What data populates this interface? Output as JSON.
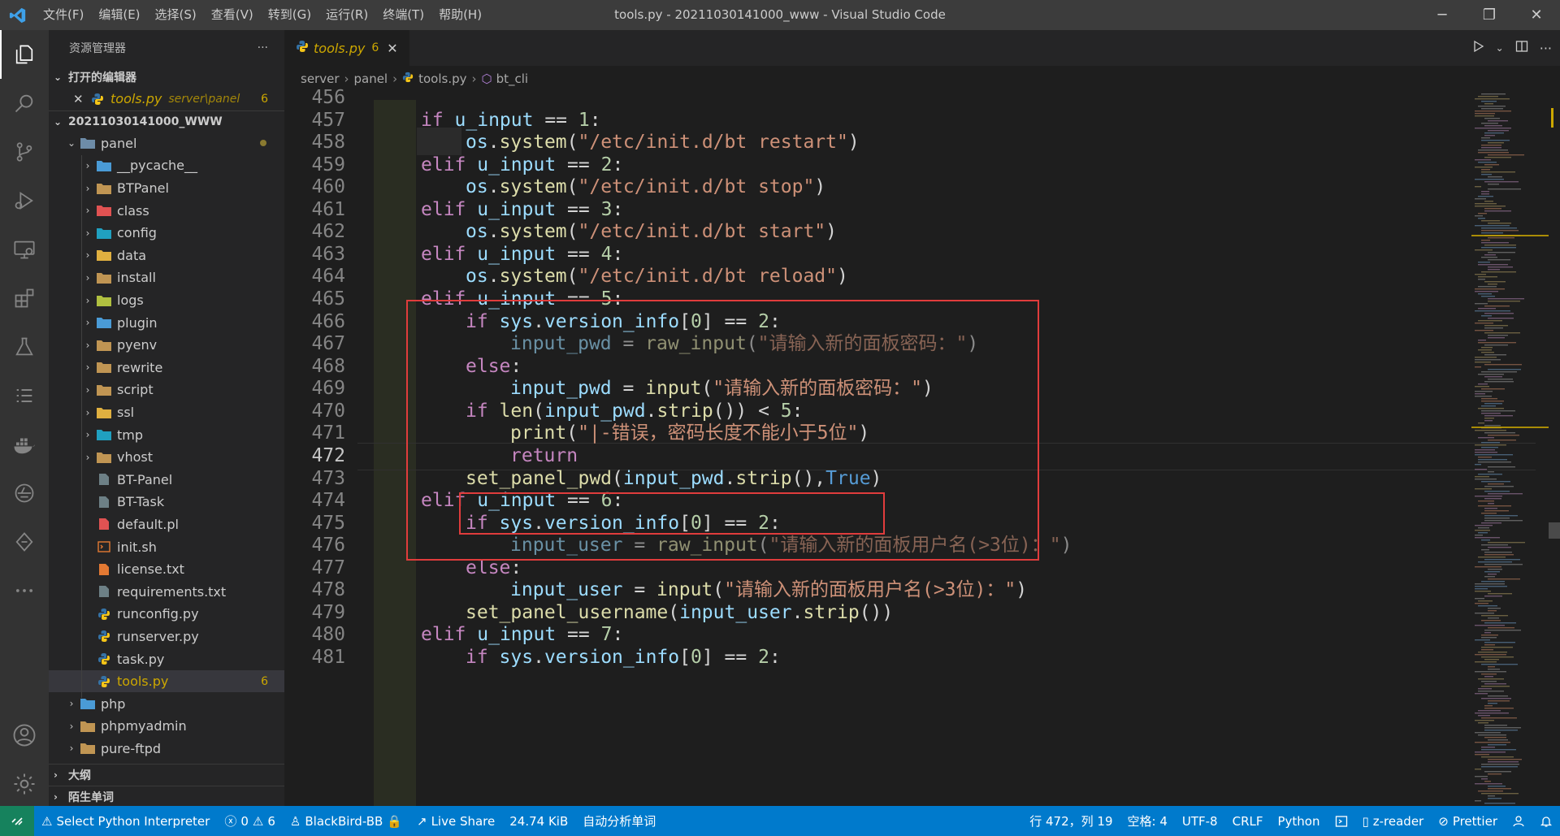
{
  "window": {
    "title": "tools.py - 20211030141000_www - Visual Studio Code",
    "menu": [
      "文件(F)",
      "编辑(E)",
      "选择(S)",
      "查看(V)",
      "转到(G)",
      "运行(R)",
      "终端(T)",
      "帮助(H)"
    ],
    "controls": {
      "minimize": "─",
      "restore": "❐",
      "close": "✕"
    }
  },
  "activity": {
    "icons": [
      "explorer-icon",
      "search-icon",
      "source-control-icon",
      "run-debug-icon",
      "remote-explorer-icon",
      "extensions-icon",
      "testing-icon",
      "list-icon",
      "docker-icon",
      "cloud-icon",
      "git-graph-icon",
      "more-icon"
    ],
    "bottom": [
      "account-icon",
      "settings-gear-icon"
    ]
  },
  "sidebar": {
    "title": "资源管理器",
    "more": "···",
    "open_editors_label": "打开的编辑器",
    "open_editor": {
      "name": "tools.py",
      "path": "server\\panel",
      "badge": "6"
    },
    "root_label": "20211030141000_WWW",
    "panel_folder": "panel",
    "items": [
      {
        "label": "__pycache__",
        "type": "folder",
        "icon": "pycache-folder-icon",
        "color": "#4a9bd6"
      },
      {
        "label": "BTPanel",
        "type": "folder",
        "icon": "folder-icon",
        "color": "#c09553"
      },
      {
        "label": "class",
        "type": "folder",
        "icon": "class-folder-icon",
        "color": "#e05252"
      },
      {
        "label": "config",
        "type": "folder",
        "icon": "config-folder-icon",
        "color": "#20a0c0"
      },
      {
        "label": "data",
        "type": "folder",
        "icon": "data-folder-icon",
        "color": "#e0b040"
      },
      {
        "label": "install",
        "type": "folder",
        "icon": "folder-icon",
        "color": "#c09553"
      },
      {
        "label": "logs",
        "type": "folder",
        "icon": "logs-folder-icon",
        "color": "#b0c040"
      },
      {
        "label": "plugin",
        "type": "folder",
        "icon": "plugin-folder-icon",
        "color": "#4a9bd6"
      },
      {
        "label": "pyenv",
        "type": "folder",
        "icon": "folder-icon",
        "color": "#c09553"
      },
      {
        "label": "rewrite",
        "type": "folder",
        "icon": "folder-icon",
        "color": "#c09553"
      },
      {
        "label": "script",
        "type": "folder",
        "icon": "folder-icon",
        "color": "#c09553"
      },
      {
        "label": "ssl",
        "type": "folder",
        "icon": "ssl-folder-icon",
        "color": "#e0b040"
      },
      {
        "label": "tmp",
        "type": "folder",
        "icon": "tmp-folder-icon",
        "color": "#20a0c0"
      },
      {
        "label": "vhost",
        "type": "folder",
        "icon": "folder-icon",
        "color": "#c09553"
      },
      {
        "label": "BT-Panel",
        "type": "file",
        "icon": "file-icon",
        "color": "#6d8086"
      },
      {
        "label": "BT-Task",
        "type": "file",
        "icon": "file-icon",
        "color": "#6d8086"
      },
      {
        "label": "default.pl",
        "type": "file",
        "icon": "perl-file-icon",
        "color": "#e05252"
      },
      {
        "label": "init.sh",
        "type": "file",
        "icon": "shell-file-icon",
        "color": "#e37933"
      },
      {
        "label": "license.txt",
        "type": "file",
        "icon": "license-file-icon",
        "color": "#e37933"
      },
      {
        "label": "requirements.txt",
        "type": "file",
        "icon": "text-file-icon",
        "color": "#6d8086"
      },
      {
        "label": "runconfig.py",
        "type": "file",
        "icon": "python-file-icon",
        "color": "#3572a5"
      },
      {
        "label": "runserver.py",
        "type": "file",
        "icon": "python-file-icon",
        "color": "#3572a5"
      },
      {
        "label": "task.py",
        "type": "file",
        "icon": "python-file-icon",
        "color": "#3572a5"
      },
      {
        "label": "tools.py",
        "type": "file",
        "icon": "python-file-icon",
        "color": "#3572a5",
        "badge": "6",
        "selected": true
      }
    ],
    "after": [
      {
        "label": "php",
        "icon": "php-folder-icon",
        "color": "#4a9bd6"
      },
      {
        "label": "phpmyadmin",
        "icon": "folder-icon",
        "color": "#c09553"
      },
      {
        "label": "pure-ftpd",
        "icon": "folder-icon",
        "color": "#c09553"
      }
    ],
    "outline_label": "大纲",
    "vocab_label": "陌生单词"
  },
  "editor": {
    "tab": {
      "name": "tools.py",
      "badge": "6",
      "close": "✕"
    },
    "breadcrumbs": [
      "server",
      "panel",
      "tools.py",
      "bt_cli"
    ],
    "current_line": 472,
    "lines": [
      {
        "n": "456",
        "i": 0,
        "t": []
      },
      {
        "n": "457",
        "i": 1,
        "t": [
          [
            "kw",
            "if "
          ],
          [
            "var",
            "u_input"
          ],
          [
            "op",
            " == "
          ],
          [
            "num",
            "1"
          ],
          [
            "op",
            ":"
          ]
        ]
      },
      {
        "n": "458",
        "i": 2,
        "t": [
          [
            "var",
            "os"
          ],
          [
            "op",
            "."
          ],
          [
            "fn",
            "system"
          ],
          [
            "op",
            "("
          ],
          [
            "str",
            "\"/etc/init.d/bt restart\""
          ],
          [
            "op",
            ")"
          ]
        ]
      },
      {
        "n": "459",
        "i": 1,
        "t": [
          [
            "kw",
            "elif "
          ],
          [
            "var",
            "u_input"
          ],
          [
            "op",
            " == "
          ],
          [
            "num",
            "2"
          ],
          [
            "op",
            ":"
          ]
        ]
      },
      {
        "n": "460",
        "i": 2,
        "t": [
          [
            "var",
            "os"
          ],
          [
            "op",
            "."
          ],
          [
            "fn",
            "system"
          ],
          [
            "op",
            "("
          ],
          [
            "str",
            "\"/etc/init.d/bt stop\""
          ],
          [
            "op",
            ")"
          ]
        ]
      },
      {
        "n": "461",
        "i": 1,
        "t": [
          [
            "kw",
            "elif "
          ],
          [
            "var",
            "u_input"
          ],
          [
            "op",
            " == "
          ],
          [
            "num",
            "3"
          ],
          [
            "op",
            ":"
          ]
        ]
      },
      {
        "n": "462",
        "i": 2,
        "t": [
          [
            "var",
            "os"
          ],
          [
            "op",
            "."
          ],
          [
            "fn",
            "system"
          ],
          [
            "op",
            "("
          ],
          [
            "str",
            "\"/etc/init.d/bt start\""
          ],
          [
            "op",
            ")"
          ]
        ]
      },
      {
        "n": "463",
        "i": 1,
        "t": [
          [
            "kw",
            "elif "
          ],
          [
            "var",
            "u_input"
          ],
          [
            "op",
            " == "
          ],
          [
            "num",
            "4"
          ],
          [
            "op",
            ":"
          ]
        ]
      },
      {
        "n": "464",
        "i": 2,
        "t": [
          [
            "var",
            "os"
          ],
          [
            "op",
            "."
          ],
          [
            "fn",
            "system"
          ],
          [
            "op",
            "("
          ],
          [
            "str",
            "\"/etc/init.d/bt reload\""
          ],
          [
            "op",
            ")"
          ]
        ]
      },
      {
        "n": "465",
        "i": 1,
        "t": [
          [
            "kw",
            "elif "
          ],
          [
            "var",
            "u_input"
          ],
          [
            "op",
            " == "
          ],
          [
            "num",
            "5"
          ],
          [
            "op",
            ":"
          ]
        ]
      },
      {
        "n": "466",
        "i": 2,
        "t": [
          [
            "kw",
            "if "
          ],
          [
            "var",
            "sys"
          ],
          [
            "op",
            "."
          ],
          [
            "var",
            "version_info"
          ],
          [
            "op",
            "["
          ],
          [
            "num",
            "0"
          ],
          [
            "op",
            "] == "
          ],
          [
            "num",
            "2"
          ],
          [
            "op",
            ":"
          ]
        ]
      },
      {
        "n": "467",
        "i": 3,
        "dim": true,
        "t": [
          [
            "var",
            "input_pwd"
          ],
          [
            "op",
            " = "
          ],
          [
            "fn",
            "raw_input"
          ],
          [
            "op",
            "("
          ],
          [
            "str",
            "\"请输入新的面板密码：\""
          ],
          [
            "op",
            ")"
          ]
        ]
      },
      {
        "n": "468",
        "i": 2,
        "t": [
          [
            "kw",
            "else"
          ],
          [
            "op",
            ":"
          ]
        ]
      },
      {
        "n": "469",
        "i": 3,
        "t": [
          [
            "var",
            "input_pwd"
          ],
          [
            "op",
            " = "
          ],
          [
            "fn",
            "input"
          ],
          [
            "op",
            "("
          ],
          [
            "str",
            "\"请输入新的面板密码：\""
          ],
          [
            "op",
            ")"
          ]
        ]
      },
      {
        "n": "470",
        "i": 2,
        "t": [
          [
            "kw",
            "if "
          ],
          [
            "fn",
            "len"
          ],
          [
            "op",
            "("
          ],
          [
            "var",
            "input_pwd"
          ],
          [
            "op",
            "."
          ],
          [
            "fn",
            "strip"
          ],
          [
            "op",
            "()) < "
          ],
          [
            "num",
            "5"
          ],
          [
            "op",
            ":"
          ]
        ]
      },
      {
        "n": "471",
        "i": 3,
        "t": [
          [
            "fn",
            "print"
          ],
          [
            "op",
            "("
          ],
          [
            "str",
            "\"|-错误，密码长度不能小于5位\""
          ],
          [
            "op",
            ")"
          ]
        ]
      },
      {
        "n": "472",
        "i": 3,
        "t": [
          [
            "kw",
            "return"
          ]
        ]
      },
      {
        "n": "473",
        "i": 2,
        "t": [
          [
            "fn",
            "set_panel_pwd"
          ],
          [
            "op",
            "("
          ],
          [
            "var",
            "input_pwd"
          ],
          [
            "op",
            "."
          ],
          [
            "fn",
            "strip"
          ],
          [
            "op",
            "(),"
          ],
          [
            "cst",
            "True"
          ],
          [
            "op",
            ")"
          ]
        ]
      },
      {
        "n": "474",
        "i": 1,
        "t": [
          [
            "kw",
            "elif "
          ],
          [
            "var",
            "u_input"
          ],
          [
            "op",
            " == "
          ],
          [
            "num",
            "6"
          ],
          [
            "op",
            ":"
          ]
        ]
      },
      {
        "n": "475",
        "i": 2,
        "t": [
          [
            "kw",
            "if "
          ],
          [
            "var",
            "sys"
          ],
          [
            "op",
            "."
          ],
          [
            "var",
            "version_info"
          ],
          [
            "op",
            "["
          ],
          [
            "num",
            "0"
          ],
          [
            "op",
            "] == "
          ],
          [
            "num",
            "2"
          ],
          [
            "op",
            ":"
          ]
        ]
      },
      {
        "n": "476",
        "i": 3,
        "dim": true,
        "t": [
          [
            "var",
            "input_user"
          ],
          [
            "op",
            " = "
          ],
          [
            "fn",
            "raw_input"
          ],
          [
            "op",
            "("
          ],
          [
            "str",
            "\"请输入新的面板用户名(>3位)：\""
          ],
          [
            "op",
            ")"
          ]
        ]
      },
      {
        "n": "477",
        "i": 2,
        "t": [
          [
            "kw",
            "else"
          ],
          [
            "op",
            ":"
          ]
        ]
      },
      {
        "n": "478",
        "i": 3,
        "t": [
          [
            "var",
            "input_user"
          ],
          [
            "op",
            " = "
          ],
          [
            "fn",
            "input"
          ],
          [
            "op",
            "("
          ],
          [
            "str",
            "\"请输入新的面板用户名(>3位)：\""
          ],
          [
            "op",
            ")"
          ]
        ]
      },
      {
        "n": "479",
        "i": 2,
        "t": [
          [
            "fn",
            "set_panel_username"
          ],
          [
            "op",
            "("
          ],
          [
            "var",
            "input_user"
          ],
          [
            "op",
            "."
          ],
          [
            "fn",
            "strip"
          ],
          [
            "op",
            "())"
          ]
        ]
      },
      {
        "n": "480",
        "i": 1,
        "t": [
          [
            "kw",
            "elif "
          ],
          [
            "var",
            "u_input"
          ],
          [
            "op",
            " == "
          ],
          [
            "num",
            "7"
          ],
          [
            "op",
            ":"
          ]
        ]
      },
      {
        "n": "481",
        "i": 2,
        "t": [
          [
            "kw",
            "if "
          ],
          [
            "var",
            "sys"
          ],
          [
            "op",
            "."
          ],
          [
            "var",
            "version_info"
          ],
          [
            "op",
            "["
          ],
          [
            "num",
            "0"
          ],
          [
            "op",
            "] == "
          ],
          [
            "num",
            "2"
          ],
          [
            "op",
            ":"
          ]
        ]
      }
    ]
  },
  "status": {
    "interpreter": "Select Python Interpreter",
    "errors": "0",
    "warnings": "6",
    "theme": "BlackBird-BB",
    "liveshare": "Live Share",
    "size": "24.74 KiB",
    "analysis": "自动分析单词",
    "position": "行 472，列 19",
    "spaces": "空格: 4",
    "encoding": "UTF-8",
    "eol": "CRLF",
    "language": "Python",
    "reader": "z-reader",
    "prettier": "Prettier"
  },
  "colors": {
    "accent": "#007acc",
    "highlight_box": "#e03c3c",
    "warning": "#cca700"
  }
}
